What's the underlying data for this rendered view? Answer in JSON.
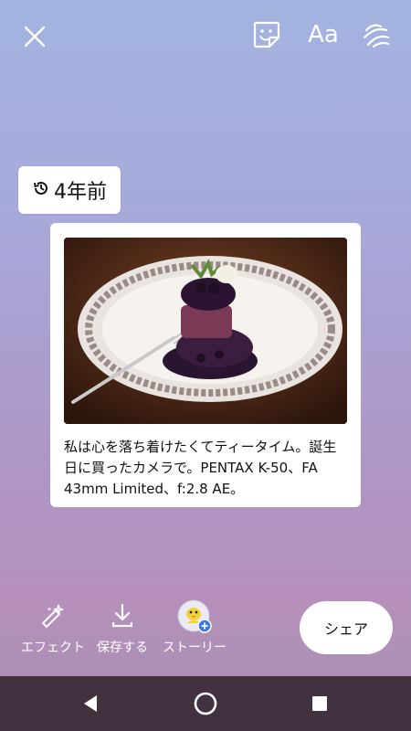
{
  "top_bar": {
    "close_icon": "close-icon",
    "sticker_icon": "sticker-icon",
    "text_label": "Aa",
    "draw_icon": "draw-icon"
  },
  "memory": {
    "icon": "history-icon",
    "label": "4年前"
  },
  "card": {
    "photo_description": "dessert-plate-photo",
    "caption": "私は心を落ち着けたくてティータイム。誕生日に買ったカメラで。PENTAX K-50、FA 43mm Limited、f:2.8 AE。"
  },
  "tools": [
    {
      "label": "エフェクト",
      "icon": "magic-wand-icon"
    },
    {
      "label": "保存する",
      "icon": "download-icon"
    },
    {
      "label": "ストーリー",
      "icon": "story-avatar-icon"
    }
  ],
  "share_label": "シェア",
  "nav": {
    "back_icon": "back-icon",
    "home_icon": "home-icon",
    "recents_icon": "recents-icon"
  },
  "colors": {
    "nav_bg": "#42323f",
    "card_bg": "#ffffff"
  }
}
